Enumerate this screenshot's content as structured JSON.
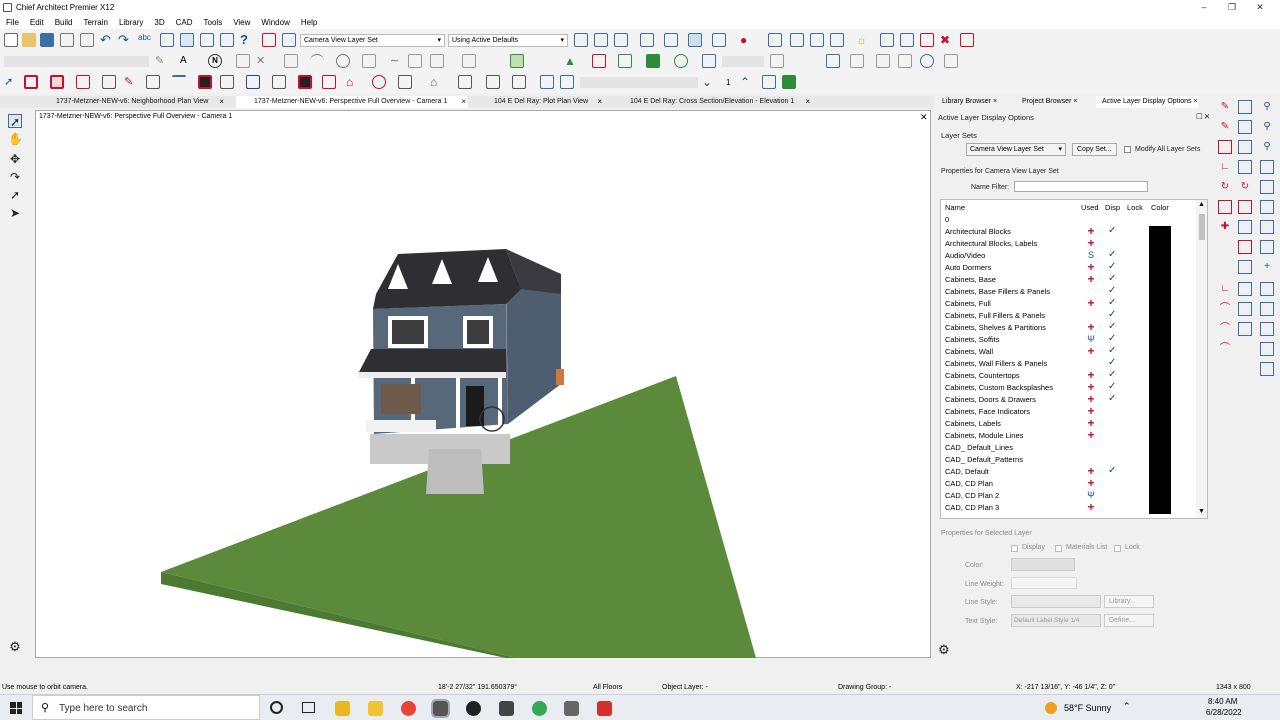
{
  "app": {
    "title": "Chief Architect Premier X12"
  },
  "menu": [
    "File",
    "Edit",
    "Build",
    "Terrain",
    "Library",
    "3D",
    "CAD",
    "Tools",
    "View",
    "Window",
    "Help"
  ],
  "toolbar": {
    "layer_set": "Camera View Layer Set",
    "defaults": "Using Active Defaults",
    "floor_num": "1"
  },
  "tabs": [
    {
      "label": "1737-Metzner-NEW-v6: Neighborhood Plan View"
    },
    {
      "label": "1737-Metzner-NEW-v6: Perspective Full Overview - Camera 1"
    },
    {
      "label": "104 E Del Ray: Plot Plan View"
    },
    {
      "label": "104 E Del Ray: Cross Section/Elevation - Elevation 1"
    }
  ],
  "viewport": {
    "title": "1737-Metzner-NEW-v6: Perspective Full Overview - Camera 1"
  },
  "panel": {
    "tabs": [
      "Library Browser",
      "Project Browser",
      "Active Layer Display Options"
    ],
    "title": "Active Layer Display Options",
    "layer_sets_label": "Layer Sets",
    "layer_set_value": "Camera View Layer Set",
    "copy_set": "Copy Set...",
    "modify_all": "Modify All Layer Sets",
    "properties_label": "Properties for Camera View Layer Set",
    "name_filter": "Name Filter:",
    "columns": {
      "name": "Name",
      "used": "Used",
      "disp": "Disp",
      "lock": "Lock",
      "color": "Color"
    },
    "layers": [
      {
        "name": "0",
        "used": "",
        "disp": ""
      },
      {
        "name": "Architectural Blocks",
        "used": "+",
        "disp": "✓"
      },
      {
        "name": "Architectural Blocks, Labels",
        "used": "+",
        "disp": ""
      },
      {
        "name": "Audio/Video",
        "used": "S",
        "disp": "✓"
      },
      {
        "name": "Auto Dormers",
        "used": "+",
        "disp": "✓"
      },
      {
        "name": "Cabinets,  Base",
        "used": "+",
        "disp": "✓"
      },
      {
        "name": "Cabinets,  Base Fillers & Panels",
        "used": "",
        "disp": "✓"
      },
      {
        "name": "Cabinets,  Full",
        "used": "+",
        "disp": "✓"
      },
      {
        "name": "Cabinets,  Full Fillers & Panels",
        "used": "",
        "disp": "✓"
      },
      {
        "name": "Cabinets,  Shelves & Partitions",
        "used": "+",
        "disp": "✓"
      },
      {
        "name": "Cabinets,  Soffits",
        "used": "Ψ",
        "disp": "✓"
      },
      {
        "name": "Cabinets,  Wall",
        "used": "+",
        "disp": "✓"
      },
      {
        "name": "Cabinets,  Wall Fillers & Panels",
        "used": "",
        "disp": "✓"
      },
      {
        "name": "Cabinets, Countertops",
        "used": "+",
        "disp": "✓"
      },
      {
        "name": "Cabinets, Custom Backsplashes",
        "used": "+",
        "disp": "✓"
      },
      {
        "name": "Cabinets, Doors & Drawers",
        "used": "+",
        "disp": "✓"
      },
      {
        "name": "Cabinets, Face Indicators",
        "used": "+",
        "disp": ""
      },
      {
        "name": "Cabinets, Labels",
        "used": "+",
        "disp": ""
      },
      {
        "name": "Cabinets, Module Lines",
        "used": "+",
        "disp": ""
      },
      {
        "name": "CAD_ Default_Lines",
        "used": "",
        "disp": ""
      },
      {
        "name": "CAD_ Default_Patterns",
        "used": "",
        "disp": ""
      },
      {
        "name": "CAD,  Default",
        "used": "+",
        "disp": "✓"
      },
      {
        "name": "CAD, CD Plan",
        "used": "+",
        "disp": ""
      },
      {
        "name": "CAD, CD Plan 2",
        "used": "Ψ",
        "disp": ""
      },
      {
        "name": "CAD, CD Plan 3",
        "used": "+",
        "disp": ""
      }
    ],
    "sel_props_label": "Properties for Selected Layer",
    "display": "Display",
    "materials_list": "Materials List",
    "lock": "Lock",
    "color": "Color:",
    "line_weight": "Line Weight:",
    "line_style": "Line Style:",
    "text_style": "Text Style:",
    "library_btn": "Library...",
    "text_style_value": "Default Label Style 1/4",
    "define_btn": "Define..."
  },
  "status": {
    "hint": "Use mouse to orbit camera.",
    "coords": "18'-2 27/32\" 191.650379°",
    "floors": "All Floors",
    "object_layer": "Object Layer: -",
    "drawing_group": "Drawing Group: -",
    "xyz": "X: -217 13/16\", Y: -46 1/4\", Z: 0\"",
    "size": "1343 x 800"
  },
  "taskbar": {
    "search": "Type here to search",
    "weather": "58°F  Sunny",
    "time": "8:40 AM",
    "date": "6/28/2022"
  },
  "colors": {
    "accent": "#0078d7",
    "used_red": "#c8102e",
    "grass": "#5a8a3a",
    "siding": "#56687a",
    "roof": "#2f2f33"
  }
}
